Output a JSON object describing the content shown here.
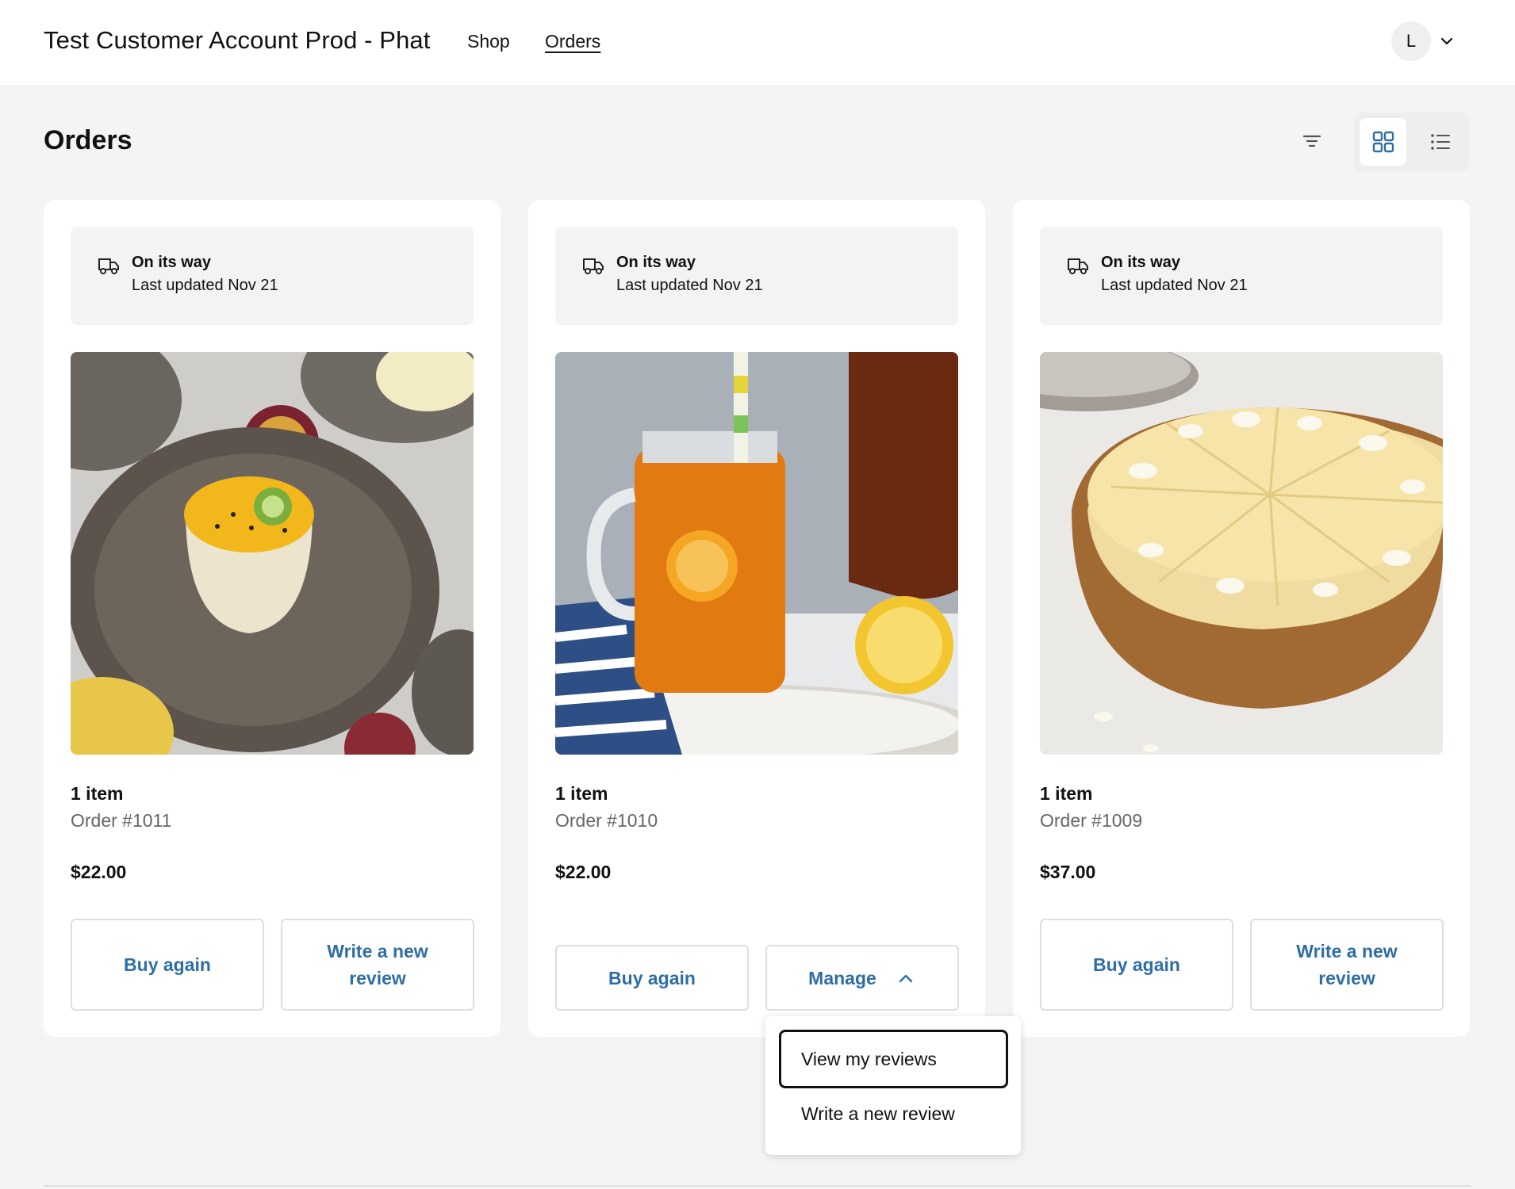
{
  "header": {
    "shop_name": "Test Customer Account Prod - Phat",
    "nav": [
      {
        "label": "Shop"
      },
      {
        "label": "Orders",
        "active": true
      }
    ],
    "avatar_initial": "L",
    "avatar_menu_icon": "chevron-down-icon"
  },
  "page": {
    "title": "Orders",
    "filter_icon": "filter-icon",
    "view_modes": [
      {
        "icon": "grid-view-icon",
        "selected": true
      },
      {
        "icon": "list-view-icon",
        "selected": false
      }
    ]
  },
  "orders": [
    {
      "status": "On its way",
      "status_updated": "Last updated Nov 21",
      "status_icon": "truck-icon",
      "image_subject": "passion fruit panna cotta",
      "item_count": "1 item",
      "order_number": "Order #1011",
      "total": "$22.00",
      "actions": [
        "Buy again",
        "Write a new review"
      ]
    },
    {
      "status": "On its way",
      "status_updated": "Last updated Nov 21",
      "status_icon": "truck-icon",
      "image_subject": "iced tea with lemon",
      "item_count": "1 item",
      "order_number": "Order #1010",
      "total": "$22.00",
      "actions": [
        "Buy again",
        "Manage"
      ],
      "manage_open": true
    },
    {
      "status": "On its way",
      "status_updated": "Last updated Nov 21",
      "status_icon": "truck-icon",
      "image_subject": "white chocolate cheesecake",
      "item_count": "1 item",
      "order_number": "Order #1009",
      "total": "$37.00",
      "actions": [
        "Buy again",
        "Write a new review"
      ]
    }
  ],
  "manage_menu": {
    "items": [
      {
        "label": "View my reviews",
        "focused": true
      },
      {
        "label": "Write a new review",
        "focused": false
      }
    ]
  },
  "colors": {
    "accent": "#2f6ea5",
    "page_bg": "#f4f4f4",
    "card_bg": "#ffffff",
    "status_bg": "#f3f3f3"
  }
}
